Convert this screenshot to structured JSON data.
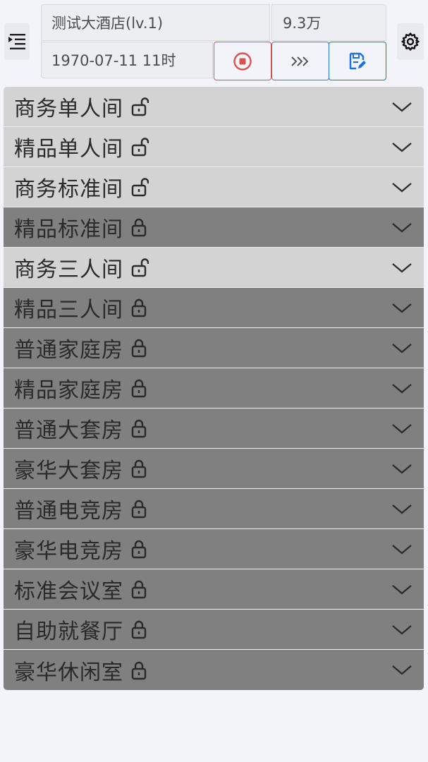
{
  "header": {
    "hotel_name": "测试大酒店(lv.1)",
    "money": "9.3万",
    "game_time": "1970-07-11 11时"
  },
  "icons": {
    "menu": "indent-menu-icon",
    "settings": "gear-icon",
    "stop": "stop-circle-icon",
    "fast_forward": "fast-forward-icon",
    "save": "save-edit-icon"
  },
  "colors": {
    "unlocked_row": "#d3d3d3",
    "locked_row": "#808080",
    "stop_accent": "#d9534f",
    "save_accent": "#1a73d9"
  },
  "rooms": [
    {
      "name": "商务单人间",
      "locked": false
    },
    {
      "name": "精品单人间",
      "locked": false
    },
    {
      "name": "商务标准间",
      "locked": false
    },
    {
      "name": "精品标准间",
      "locked": true
    },
    {
      "name": "商务三人间",
      "locked": false
    },
    {
      "name": "精品三人间",
      "locked": true
    },
    {
      "name": "普通家庭房",
      "locked": true
    },
    {
      "name": "精品家庭房",
      "locked": true
    },
    {
      "name": "普通大套房",
      "locked": true
    },
    {
      "name": "豪华大套房",
      "locked": true
    },
    {
      "name": "普通电竞房",
      "locked": true
    },
    {
      "name": "豪华电竞房",
      "locked": true
    },
    {
      "name": "标准会议室",
      "locked": true
    },
    {
      "name": "自助就餐厅",
      "locked": true
    },
    {
      "name": "豪华休闲室",
      "locked": true
    }
  ]
}
